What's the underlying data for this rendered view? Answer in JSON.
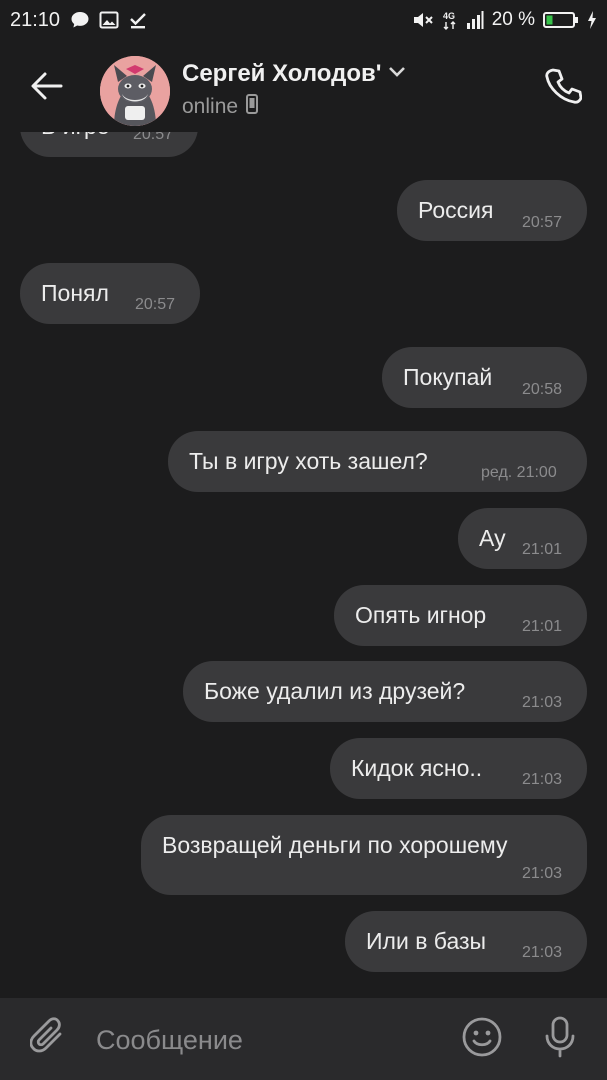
{
  "status_bar": {
    "time": "21:10",
    "battery_percent": "20 %",
    "icons_left": [
      "chat-notification-icon",
      "image-notification-icon",
      "download-done-icon"
    ],
    "icons_right": [
      "mute-icon",
      "4g-icon",
      "signal-icon",
      "battery-icon",
      "charging-icon"
    ]
  },
  "header": {
    "contact_name": "Сергей Холодов'",
    "status": "online",
    "icons": [
      "back-arrow-icon",
      "chevron-down-icon",
      "mobile-icon",
      "phone-icon"
    ]
  },
  "messages": [
    {
      "direction": "in",
      "text": "В игре",
      "time": "20:57"
    },
    {
      "direction": "out",
      "text": "Россия",
      "time": "20:57"
    },
    {
      "direction": "in",
      "text": "Понял",
      "time": "20:57"
    },
    {
      "direction": "out",
      "text": "Покупай",
      "time": "20:58"
    },
    {
      "direction": "out",
      "text": "Ты в игру хоть зашел?",
      "time": "ред. 21:00"
    },
    {
      "direction": "out",
      "text": "Ау",
      "time": "21:01"
    },
    {
      "direction": "out",
      "text": "Опять игнор",
      "time": "21:01"
    },
    {
      "direction": "out",
      "text": "Боже удалил из друзей?",
      "time": "21:03"
    },
    {
      "direction": "out",
      "text": "Кидок ясно..",
      "time": "21:03"
    },
    {
      "direction": "out",
      "text": "Возвращей деньги по хорошему",
      "time": "21:03"
    },
    {
      "direction": "out",
      "text": "Или в базы",
      "time": "21:03"
    }
  ],
  "composer": {
    "placeholder": "Сообщение",
    "icons": [
      "paperclip-icon",
      "emoji-icon",
      "microphone-icon"
    ]
  },
  "colors": {
    "background": "#1c1c1d",
    "bubble": "#3a3a3c",
    "composer": "#2a2a2c",
    "text": "#ececec",
    "timestamp": "#8b8b8d"
  }
}
